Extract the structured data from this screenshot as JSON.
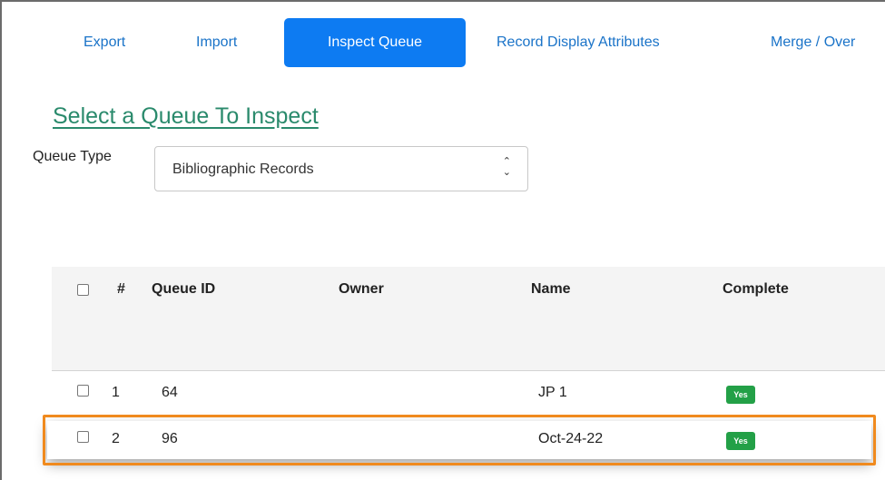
{
  "tabs": [
    {
      "label": "Export",
      "active": false
    },
    {
      "label": "Import",
      "active": false
    },
    {
      "label": "Inspect Queue",
      "active": true
    },
    {
      "label": "Record Display Attributes",
      "active": false
    },
    {
      "label": "Merge / Over",
      "active": false
    }
  ],
  "page_title": "Select a Queue To Inspect",
  "queue_type": {
    "label": "Queue Type",
    "value": "Bibliographic Records"
  },
  "table": {
    "headers": {
      "num": "#",
      "queue_id": "Queue ID",
      "owner": "Owner",
      "name": "Name",
      "complete": "Complete"
    },
    "rows": [
      {
        "num": "1",
        "queue_id": "64",
        "owner": "",
        "name": "JP 1",
        "complete": "Yes"
      },
      {
        "num": "2",
        "queue_id": "96",
        "owner": "",
        "name": "Oct-24-22",
        "complete": "Yes"
      }
    ]
  },
  "colors": {
    "accent": "#0d7bf2",
    "title": "#2a8a6c",
    "badge": "#23a047",
    "highlight": "#f08a1e"
  }
}
